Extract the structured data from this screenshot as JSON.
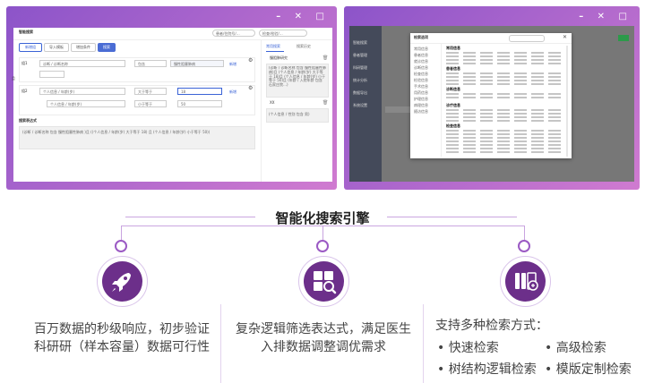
{
  "left_screenshot": {
    "window_title": "智能搜索",
    "search_placeholder": "患者/住院号/…",
    "search_placeholder2": "检查/检验/…",
    "toolbar": {
      "new_btn": "新增组",
      "import_btn": "导入模板",
      "cond_btn": "增加条件",
      "search_btn": "搜索"
    },
    "group1": {
      "label": "组1",
      "field": "诊断 / 诊断名称",
      "op": "包含",
      "value": "慢性阻塞肺病",
      "add": "新增"
    },
    "and_label": "且",
    "group2": {
      "label": "组2",
      "field": "个人信息 / 年龄(岁)",
      "op": "大于等于",
      "value": "18",
      "add": "新增",
      "field2": "个人信息 / 年龄(岁)",
      "op2": "小于等于",
      "value2": "50"
    },
    "expr_title": "搜索表达式",
    "expr_text": "(诊断 / 诊断名称 包含 慢性阻塞性肺病 )且 ((个人信息 / 年龄(岁) 大于等于 18) 且 (个人信息 / 年龄(岁) 小于等于 50))",
    "side_tabs": [
      "常用搜索",
      "搜索历史"
    ],
    "side_item1": "慢阻肺研究",
    "side_item1_text": "(诊断 / 诊断名称 包含 慢性阻塞性肺病)且 (个人信息 / 年龄(岁) 大于等于 18)且 (个人信息 / 年龄(岁) 小于等于 50)且 (年龄 / 入院年龄 包含 石家庄院…)",
    "side_item2": "XX",
    "side_item2_text": "(个人信息 / 性别 包含 男)"
  },
  "right_screenshot": {
    "window_title": "智能搜索",
    "dialog_title": "检索选项",
    "sidebar": [
      "智能搜索",
      "患者管理",
      "科研管理",
      "统计分析",
      "数据导出",
      "系统设置"
    ],
    "categories": [
      "常用信息",
      "患者信息",
      "就诊信息",
      "诊断信息",
      "检查信息",
      "检验信息",
      "手术信息",
      "用药信息",
      "护理信息",
      "病理信息",
      "随访信息"
    ],
    "sections": [
      "常用信息",
      "患者信息",
      "诊断信息",
      "诊疗信息",
      "检查信息"
    ]
  },
  "main": {
    "title": "智能化搜索引擎",
    "features": [
      {
        "icon": "rocket-icon",
        "text": "百万数据的秒级响应，初步验证科研研（样本容量）数据可行性"
      },
      {
        "icon": "search-grid-icon",
        "text": "复杂逻辑筛选表达式，满足医生入排数据调整调优需求"
      },
      {
        "icon": "database-search-icon",
        "text": "支持多种检索方式：",
        "bullets": [
          "快速检索",
          "高级检索",
          "树结构逻辑检索",
          "模版定制检索"
        ]
      }
    ]
  },
  "colors": {
    "accent": "#6c2f8a",
    "line": "#c9a4e0",
    "gradient_start": "#8c54c9",
    "gradient_end": "#d07bd0"
  }
}
